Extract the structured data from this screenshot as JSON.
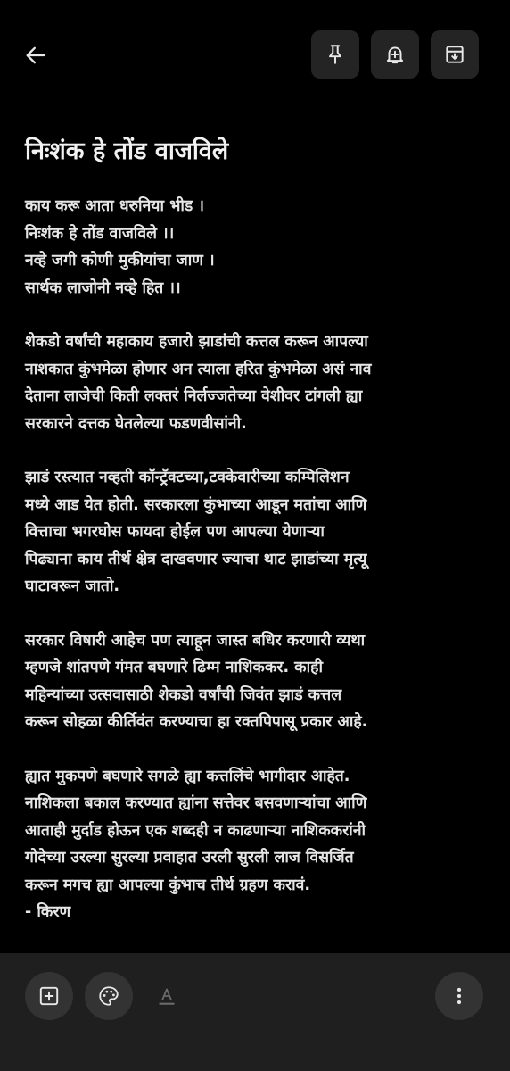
{
  "toolbar": {
    "back_icon": "arrow-left-icon",
    "pin_icon": "pin-icon",
    "reminder_icon": "bell-plus-icon",
    "archive_icon": "archive-icon"
  },
  "note": {
    "title": "निःशंक हे तोंड वाजविले",
    "paragraphs": [
      {
        "lines": [
          "काय करू आता धरुनिया भीड ।",
          "निःशंक हे तोंड वाजविले ।।",
          "नव्हे जगी कोणी मुकीयांचा जाण ।",
          "सार्थक लाजोनी नव्हे हित ।।"
        ]
      },
      {
        "lines": [
          "शेकडो वर्षांची महाकाय हजारो झाडांची कत्तल करून आपल्या",
          "नाशकात कुंभमेळा होणार अन त्याला हरित कुंभमेळा असं नाव",
          "देताना लाजेची किती लक्तरं निर्लज्जतेच्या वेशीवर टांगली ह्या",
          "सरकारने दत्तक घेतलेल्या फडणवीसांनी."
        ]
      },
      {
        "lines": [
          "झाडं रस्त्यात नव्हती कॉन्ट्रॅक्टच्या,टक्केवारीच्या कम्पिलिशन",
          "मध्ये आड येत होती.  सरकारला कुंभाच्या आडून मतांचा आणि",
          "वित्ताचा भगरघोस फायदा होईल पण आपल्या येणाऱ्या",
          "पिढ्याना काय तीर्थ क्षेत्र दाखवणार ज्याचा थाट झाडांच्या मृत्यू",
          "घाटावरून जातो."
        ]
      },
      {
        "lines": [
          "सरकार विषारी आहेच पण त्याहून जास्त बधिर करणारी व्यथा",
          "म्हणजे शांतपणे गंमत बघणारे ढिम्म नाशिककर. काही",
          "महिन्यांच्या उत्सवासाठी शेकडो वर्षांची जिवंत झाडं कत्तल",
          "करून सोहळा कीर्तिवंत करण्याचा हा रक्तपिपासू प्रकार आहे."
        ]
      },
      {
        "lines": [
          "ह्यात मुकपणे बघणारे सगळे ह्या कत्तलिंचे भागीदार आहेत.",
          "नाशिकला बकाल करण्यात ह्यांना सत्तेवर बसवणाऱ्यांचा आणि",
          "आताही मुर्दाड होऊन एक शब्दही न काढणाऱ्या नाशिककरांनी",
          "गोदेच्या उरल्या सुरल्या प्रवाहात उरली सुरली लाज विसर्जित",
          "करून मगच ह्या आपल्या कुंभाच तीर्थ ग्रहण करावं.",
          "- किरण"
        ]
      }
    ]
  },
  "bottombar": {
    "add_icon": "add-box-icon",
    "palette_icon": "palette-icon",
    "text_format_icon": "text-format-icon",
    "more_icon": "more-vertical-icon"
  },
  "colors": {
    "background": "#000000",
    "text": "#e6e6e6",
    "button_bg": "#242424",
    "bottombar_bg": "#1f1f1f",
    "fab_bg": "#333333"
  }
}
